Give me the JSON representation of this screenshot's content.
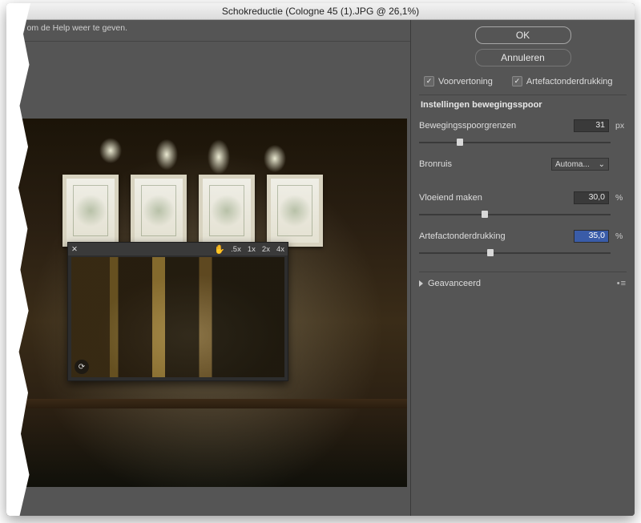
{
  "title": "Schokreductie (Cologne 45 (1).JPG @ 26,1%)",
  "help_fragment": "ent om de Help weer te geven.",
  "buttons": {
    "ok": "OK",
    "cancel": "Annuleren"
  },
  "checks": {
    "preview": "Voorvertoning",
    "artifact_suppress": "Artefactonderdrukking"
  },
  "section_trace": "Instellingen bewegingsspoor",
  "trace_bounds": {
    "label": "Bewegingsspoorgrenzen",
    "value": "31",
    "unit": "px",
    "pos_pct": 18
  },
  "source_noise": {
    "label": "Bronruis",
    "value": "Automa..."
  },
  "smoothing": {
    "label": "Vloeiend maken",
    "value": "30,0",
    "unit": "%",
    "pos_pct": 30
  },
  "artifact": {
    "label": "Artefactonderdrukking",
    "value": "35,0",
    "unit": "%",
    "pos_pct": 33
  },
  "advanced": "Geavanceerd",
  "loupe": {
    "z05": ".5x",
    "z1": "1x",
    "z2": "2x",
    "z4": "4x",
    "close": "✕",
    "hand": "✋",
    "corner": "⟳"
  }
}
